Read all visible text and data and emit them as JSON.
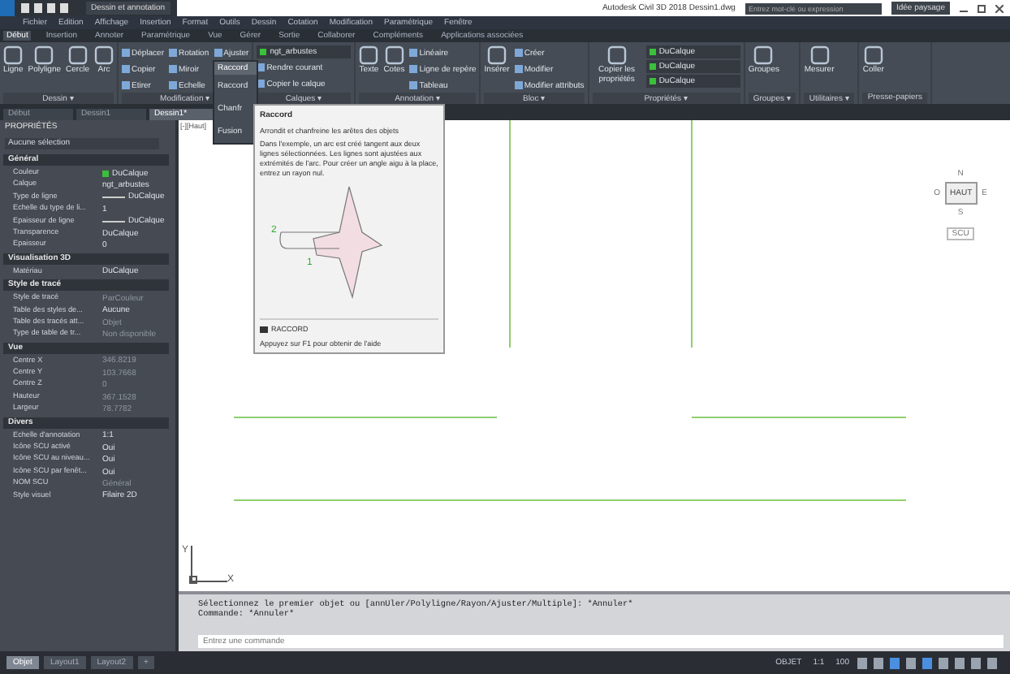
{
  "title_bar": {
    "workspace": "Dessin et annotation",
    "app_title": "Autodesk Civil 3D 2018   Dessin1.dwg",
    "search": {
      "placeholder": "Entrez mot-clé ou expression"
    },
    "user": "Idée paysage"
  },
  "menu": [
    "Fichier",
    "Edition",
    "Affichage",
    "Insertion",
    "Format",
    "Outils",
    "Dessin",
    "Cotation",
    "Modification",
    "Paramétrique",
    "Fenêtre"
  ],
  "ribbon_tabs": [
    {
      "label": "Début",
      "selected": true
    },
    {
      "label": "Insertion",
      "selected": false
    },
    {
      "label": "Annoter",
      "selected": false
    },
    {
      "label": "Paramétrique",
      "selected": false
    },
    {
      "label": "Vue",
      "selected": false
    },
    {
      "label": "Gérer",
      "selected": false
    },
    {
      "label": "Sortie",
      "selected": false
    },
    {
      "label": "Collaborer",
      "selected": false
    },
    {
      "label": "Compléments",
      "selected": false
    },
    {
      "label": "Applications associées",
      "selected": false
    }
  ],
  "ribbon_panels": [
    {
      "label": "Dessin ▾",
      "tools": [
        {
          "kind": "large",
          "label": "Ligne"
        },
        {
          "kind": "large",
          "label": "Polyligne"
        },
        {
          "kind": "large",
          "label": "Cercle"
        },
        {
          "kind": "large",
          "label": "Arc"
        }
      ]
    },
    {
      "label": "Modification ▾",
      "tools": [
        {
          "kind": "small",
          "label": "Déplacer"
        },
        {
          "kind": "small",
          "label": "Copier"
        },
        {
          "kind": "small",
          "label": "Etirer"
        },
        {
          "kind": "small",
          "label": "Rotation"
        },
        {
          "kind": "small",
          "label": "Miroir"
        },
        {
          "kind": "small",
          "label": "Echelle"
        },
        {
          "kind": "small",
          "label": "Ajuster"
        }
      ]
    },
    {
      "label": "Calques ▾",
      "tools": [
        {
          "kind": "combo",
          "label": "ngt_arbustes"
        },
        {
          "kind": "small",
          "label": "Rendre courant"
        },
        {
          "kind": "small",
          "label": "Copier le calque"
        }
      ]
    },
    {
      "label": "Annotation ▾",
      "tools": [
        {
          "kind": "large",
          "label": "Texte"
        },
        {
          "kind": "large",
          "label": "Cotes"
        },
        {
          "kind": "small",
          "label": "Linéaire"
        },
        {
          "kind": "small",
          "label": "Ligne de repère"
        },
        {
          "kind": "small",
          "label": "Tableau"
        }
      ]
    },
    {
      "label": "Bloc ▾",
      "tools": [
        {
          "kind": "large",
          "label": "Insérer"
        },
        {
          "kind": "small",
          "label": "Créer"
        },
        {
          "kind": "small",
          "label": "Modifier"
        },
        {
          "kind": "small",
          "label": "Modifier attributs"
        }
      ]
    },
    {
      "label": "Propriétés ▾",
      "tools": [
        {
          "kind": "large",
          "label": "Copier les propriétés"
        },
        {
          "kind": "combo",
          "label": "DuCalque"
        },
        {
          "kind": "combo",
          "label": "DuCalque"
        },
        {
          "kind": "combo",
          "label": "DuCalque"
        }
      ]
    },
    {
      "label": "Groupes ▾",
      "tools": [
        {
          "kind": "large",
          "label": "Groupes"
        }
      ]
    },
    {
      "label": "Utilitaires ▾",
      "tools": [
        {
          "kind": "large",
          "label": "Mesurer"
        }
      ]
    },
    {
      "label": "Presse-papiers",
      "tools": [
        {
          "kind": "large",
          "label": "Coller"
        }
      ]
    }
  ],
  "fillet_menu": {
    "button": "Raccord",
    "items": [
      "Raccord",
      "Chanfr",
      "Fusion"
    ]
  },
  "tooltip": {
    "title": "Raccord",
    "summary": "Arrondit et chanfreine les arêtes des objets",
    "description": "Dans l'exemple, un arc est créé tangent aux deux lignes sélectionnées. Les lignes sont ajustées aux extrémités de l'arc. Pour créer un angle aigu à la place, entrez un rayon nul.",
    "markers": [
      "1",
      "2"
    ],
    "command": "RACCORD",
    "help": "Appuyez sur F1 pour obtenir de l'aide"
  },
  "doc_tabs": [
    {
      "label": "Début",
      "selected": false
    },
    {
      "label": "Dessin1",
      "selected": false
    },
    {
      "label": "Dessin1*",
      "selected": true
    }
  ],
  "properties": {
    "title": "PROPRIÉTÉS",
    "selection": "Aucune sélection",
    "sections": [
      {
        "title": "Général",
        "rows": [
          {
            "name": "Couleur",
            "value": "DuCalque",
            "kind": "color"
          },
          {
            "name": "Calque",
            "value": "ngt_arbustes",
            "kind": "text"
          },
          {
            "name": "Type de ligne",
            "value": "DuCalque",
            "kind": "line"
          },
          {
            "name": "Echelle du type de li...",
            "value": "1",
            "kind": "text"
          },
          {
            "name": "Epaisseur de ligne",
            "value": "DuCalque",
            "kind": "line"
          },
          {
            "name": "Transparence",
            "value": "DuCalque",
            "kind": "text"
          },
          {
            "name": "Epaisseur",
            "value": "0",
            "kind": "text"
          }
        ]
      },
      {
        "title": "Visualisation 3D",
        "rows": [
          {
            "name": "Matériau",
            "value": "DuCalque",
            "kind": "text"
          }
        ]
      },
      {
        "title": "Style de tracé",
        "rows": [
          {
            "name": "Style de tracé",
            "value": "ParCouleur",
            "kind": "dim"
          },
          {
            "name": "Table des styles de...",
            "value": "Aucune",
            "kind": "text"
          },
          {
            "name": "Table des tracés att...",
            "value": "Objet",
            "kind": "dim"
          },
          {
            "name": "Type de table de tr...",
            "value": "Non disponible",
            "kind": "dim"
          }
        ]
      },
      {
        "title": "Vue",
        "rows": [
          {
            "name": "Centre X",
            "value": "346.8219",
            "kind": "dim"
          },
          {
            "name": "Centre Y",
            "value": "103.7668",
            "kind": "dim"
          },
          {
            "name": "Centre Z",
            "value": "0",
            "kind": "dim"
          },
          {
            "name": "Hauteur",
            "value": "367.1528",
            "kind": "dim"
          },
          {
            "name": "Largeur",
            "value": "78.7782",
            "kind": "dim"
          }
        ]
      },
      {
        "title": "Divers",
        "rows": [
          {
            "name": "Echelle d'annotation",
            "value": "1:1",
            "kind": "text"
          },
          {
            "name": "Icône SCU activé",
            "value": "Oui",
            "kind": "text"
          },
          {
            "name": "Icône SCU au niveau...",
            "value": "Oui",
            "kind": "text"
          },
          {
            "name": "Icône SCU par fenêt...",
            "value": "Oui",
            "kind": "text"
          },
          {
            "name": "NOM SCU",
            "value": "Général",
            "kind": "dim"
          },
          {
            "name": "Style visuel",
            "value": "Filaire 2D",
            "kind": "text"
          }
        ]
      }
    ]
  },
  "viewport_label": "[-][Haut]",
  "viewcube": {
    "face": "HAUT",
    "north": "N",
    "south": "S",
    "east": "E",
    "west": "O",
    "ucs": "SCU"
  },
  "axes": {
    "x": "X",
    "y": "Y"
  },
  "command_line": {
    "history": [
      "Sélectionnez le premier objet ou [annUler/Polyligne/Rayon/Ajuster/Multiple]: *Annuler*",
      "Commande: *Annuler*"
    ],
    "placeholder": "Entrez une commande"
  },
  "layout_tabs": [
    {
      "label": "Objet",
      "selected": true
    },
    {
      "label": "Layout1",
      "selected": false
    },
    {
      "label": "Layout2",
      "selected": false
    },
    {
      "label": "+",
      "selected": false
    }
  ],
  "status_bar": [
    "OBJET",
    "1:1",
    "100"
  ]
}
